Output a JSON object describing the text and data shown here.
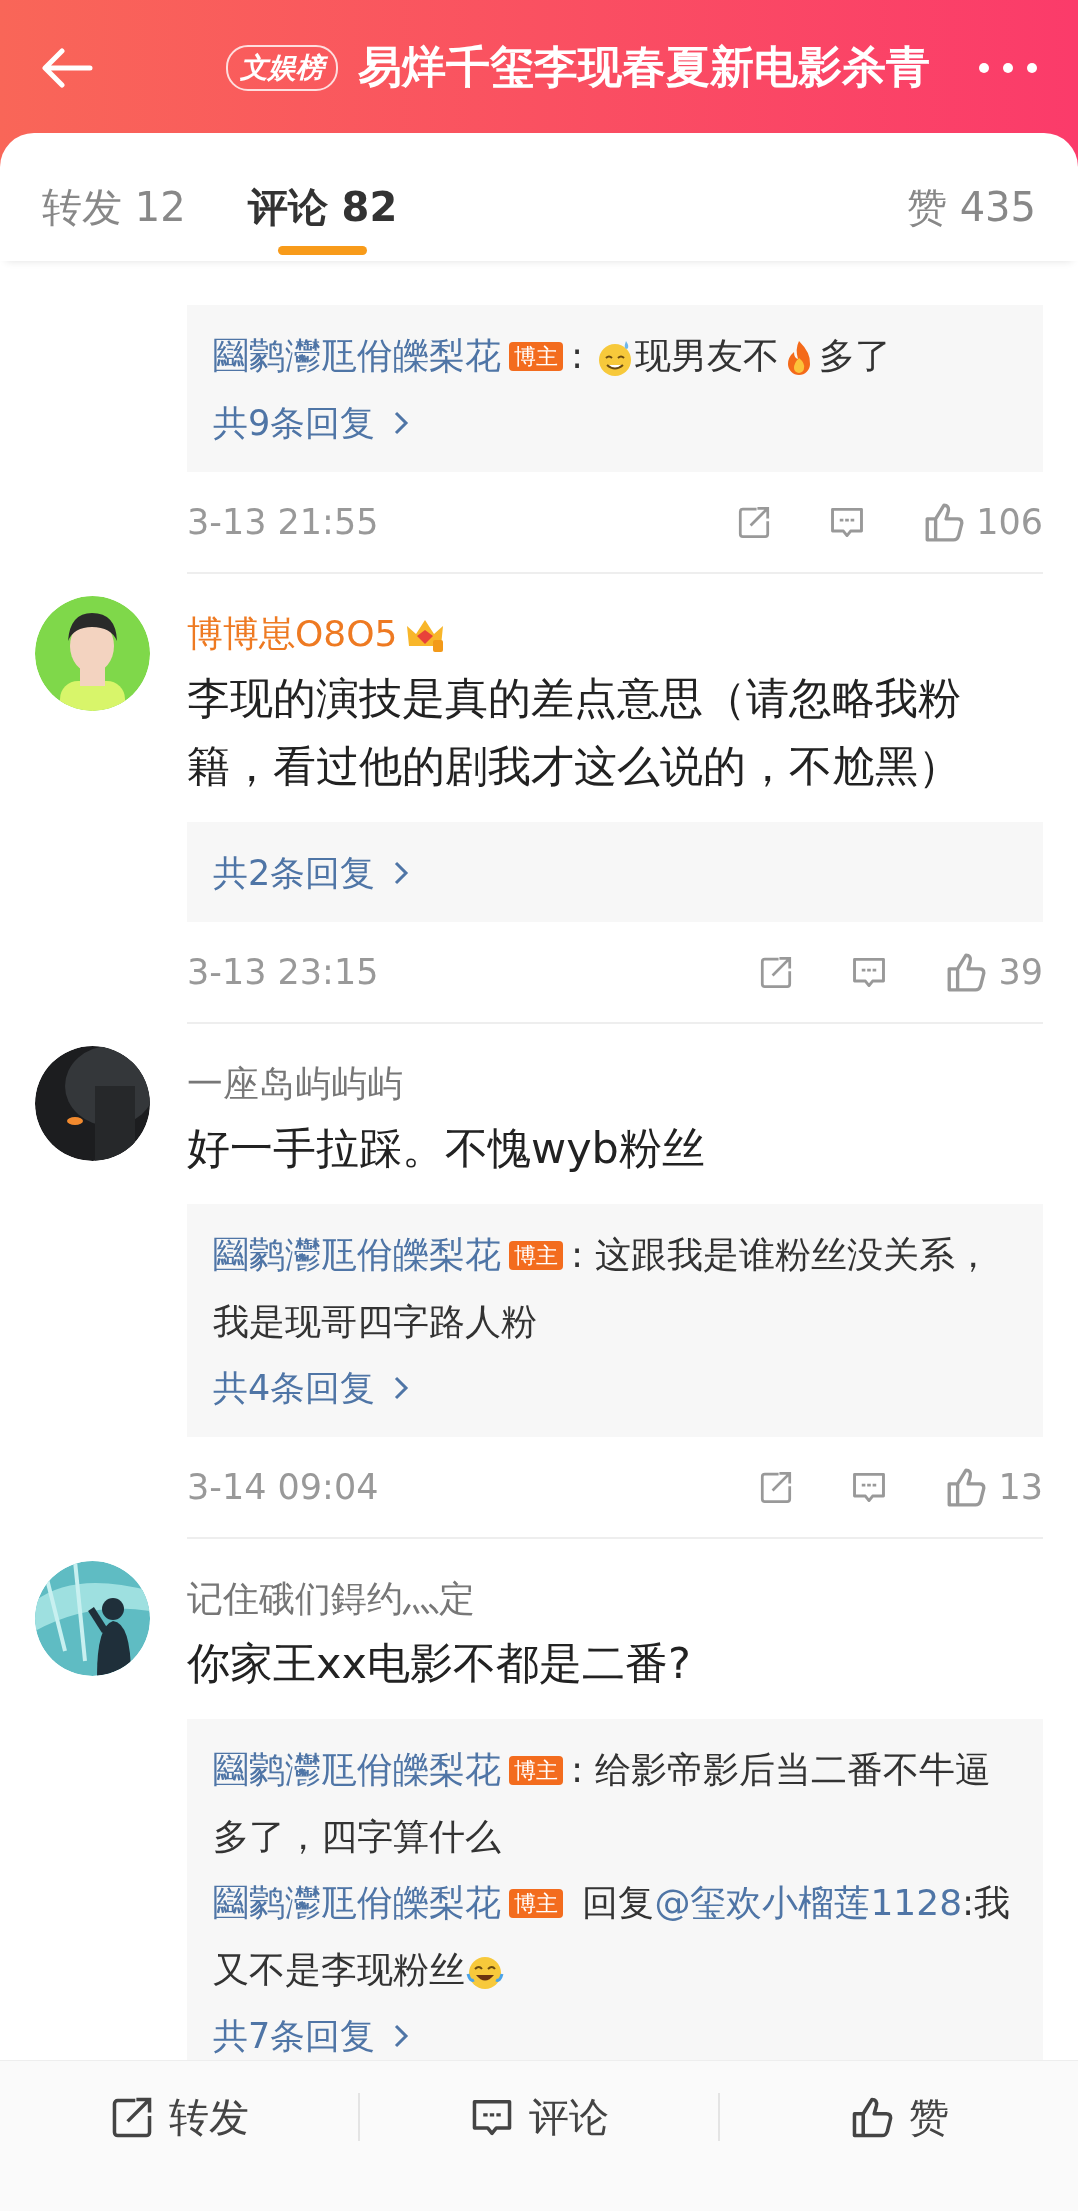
{
  "header": {
    "badge": "文娱榜",
    "title": "易烊千玺李现春夏新电影杀青"
  },
  "tabs": [
    {
      "label": "转发 12",
      "selected": false
    },
    {
      "label": "评论 82",
      "selected": true
    },
    {
      "label": "赞 435",
      "selected": false
    }
  ],
  "comments": [
    {
      "replies": [
        {
          "author": "圝鹲灪尫佾皪梨花",
          "badge": "博主",
          "segments": [
            {
              "kind": "text",
              "text": ": "
            },
            {
              "kind": "sweat"
            },
            {
              "kind": "text",
              "text": "现男友不"
            },
            {
              "kind": "fire"
            },
            {
              "kind": "text",
              "text": "多了"
            }
          ]
        }
      ],
      "more": "共9条回复",
      "time": "3-13 21:55",
      "likes": "106"
    },
    {
      "avatar": {
        "kind": "picture"
      },
      "author": "博博崽O8O5",
      "vip": true,
      "text": "李现的演技是真的差点意思（请忽略我粉籍，看过他的剧我才这么说的，不尬黑）",
      "more": "共2条回复",
      "time": "3-13 23:15",
      "likes": "39"
    },
    {
      "avatar": {
        "kind": "picture"
      },
      "author": "一座岛屿屿屿",
      "vip": false,
      "text": "好一手拉踩。不愧wyb粉丝",
      "replies": [
        {
          "author": "圝鹲灪尫佾皪梨花",
          "badge": "博主",
          "segments": [
            {
              "kind": "text",
              "text": ": 这跟我是谁粉丝没关系，我是现哥四字路人粉"
            }
          ]
        }
      ],
      "more": "共4条回复",
      "time": "3-14 09:04",
      "likes": "13"
    },
    {
      "avatar": {
        "kind": "picture"
      },
      "author": "记住硪们鍀约灬定",
      "vip": false,
      "text": "你家王xx电影不都是二番?",
      "replies": [
        {
          "author": "圝鹲灪尫佾皪梨花",
          "badge": "博主",
          "segments": [
            {
              "kind": "text",
              "text": ": 给影帝影后当二番不牛逼多了，四字算什么"
            }
          ]
        },
        {
          "author": "圝鹲灪尫佾皪梨花",
          "badge": "博主",
          "segments": [
            {
              "kind": "text",
              "text": " 回复"
            },
            {
              "kind": "mention",
              "text": "@玺欢小榴莲1128"
            },
            {
              "kind": "text",
              "text": ":我又不是李现粉丝"
            },
            {
              "kind": "laugh"
            }
          ]
        }
      ],
      "more": "共7条回复"
    }
  ],
  "bottom_bar": [
    {
      "kind": "share",
      "label": "转发"
    },
    {
      "kind": "comment",
      "label": "评论"
    },
    {
      "kind": "like",
      "label": "赞"
    }
  ]
}
